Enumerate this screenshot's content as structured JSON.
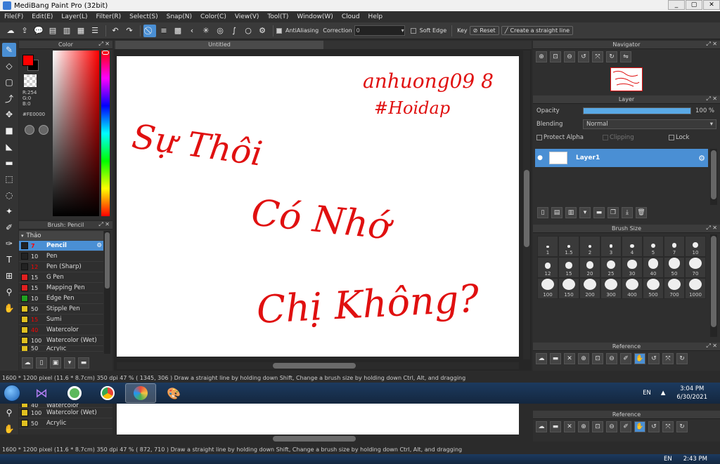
{
  "window": {
    "title": "MediBang Paint Pro (32bit)",
    "min": "_",
    "max": "▢",
    "close": "✕"
  },
  "menu": [
    "File(F)",
    "Edit(E)",
    "Layer(L)",
    "Filter(R)",
    "Select(S)",
    "Snap(N)",
    "Color(C)",
    "View(V)",
    "Tool(T)",
    "Window(W)",
    "Cloud",
    "Help"
  ],
  "toolbar": {
    "antialias_label": "AntiAliasing",
    "correction_label": "Correction",
    "correction_value": "0",
    "soft_edge_label": "Soft Edge",
    "key_label": "Key",
    "reset_label": "Reset",
    "straight_line_label": "Create a straight line"
  },
  "color_panel": {
    "title": "Color",
    "r": "R:254",
    "g": "G:0",
    "b": "B:0",
    "hex": "#FE0000",
    "primary": "#fe0000"
  },
  "brush_panel": {
    "title": "Brush: Pencil",
    "group": "Thảo",
    "items": [
      {
        "size": "7",
        "name": "Pencil",
        "color": "#222222",
        "selected": true
      },
      {
        "size": "10",
        "name": "Pen",
        "color": "#222222"
      },
      {
        "size": "12",
        "name": "Pen (Sharp)",
        "color": "#222222"
      },
      {
        "size": "15",
        "name": "G Pen",
        "color": "#e02020"
      },
      {
        "size": "15",
        "name": "Mapping Pen",
        "color": "#e02020"
      },
      {
        "size": "10",
        "name": "Edge Pen",
        "color": "#20a020"
      },
      {
        "size": "50",
        "name": "Stipple Pen",
        "color": "#e0c020"
      },
      {
        "size": "15",
        "name": "Sumi",
        "color": "#e0c020"
      },
      {
        "size": "40",
        "name": "Watercolor",
        "color": "#e0c020"
      },
      {
        "size": "100",
        "name": "Watercolor (Wet)",
        "color": "#e0c020"
      },
      {
        "size": "50",
        "name": "Acrylic",
        "color": "#e0c020"
      }
    ]
  },
  "canvas": {
    "tab": "Untitled",
    "text_lines": [
      "anhuong09 8",
      "#Hoidap",
      "Sự Thôi",
      "Có Nhớ",
      "Chị Không?"
    ],
    "ink": "#e01010"
  },
  "navigator": {
    "title": "Navigator"
  },
  "layer_panel": {
    "title": "Layer",
    "opacity_label": "Opacity",
    "opacity_value": "100 %",
    "opacity": 1.0,
    "blending_label": "Blending",
    "blending_value": "Normal",
    "protect_alpha": "Protect Alpha",
    "clipping": "Clipping",
    "lock": "Lock",
    "layer_name": "Layer1"
  },
  "brush_size": {
    "title": "Brush Size",
    "sizes": [
      "1",
      "1.5",
      "2",
      "3",
      "4",
      "5",
      "7",
      "10",
      "12",
      "15",
      "20",
      "25",
      "30",
      "40",
      "50",
      "70",
      "100",
      "150",
      "200",
      "300",
      "400",
      "500",
      "700",
      "1000"
    ]
  },
  "reference": {
    "title": "Reference"
  },
  "status": {
    "dims": "1600 * 1200 pixel",
    "cm": "(11.6 * 8.7cm)",
    "dpi": "350 dpi",
    "zoom": "47 %",
    "coords": "( 1345, 306 )",
    "hint": "Draw a straight line by holding down Shift, Change a brush size by holding down Ctrl, Alt, and dragging",
    "coords2": "( 872, 710 )"
  },
  "taskbar": {
    "lang": "EN",
    "time": "3:04 PM",
    "date": "6/30/2021",
    "time2": "2:43 PM"
  }
}
